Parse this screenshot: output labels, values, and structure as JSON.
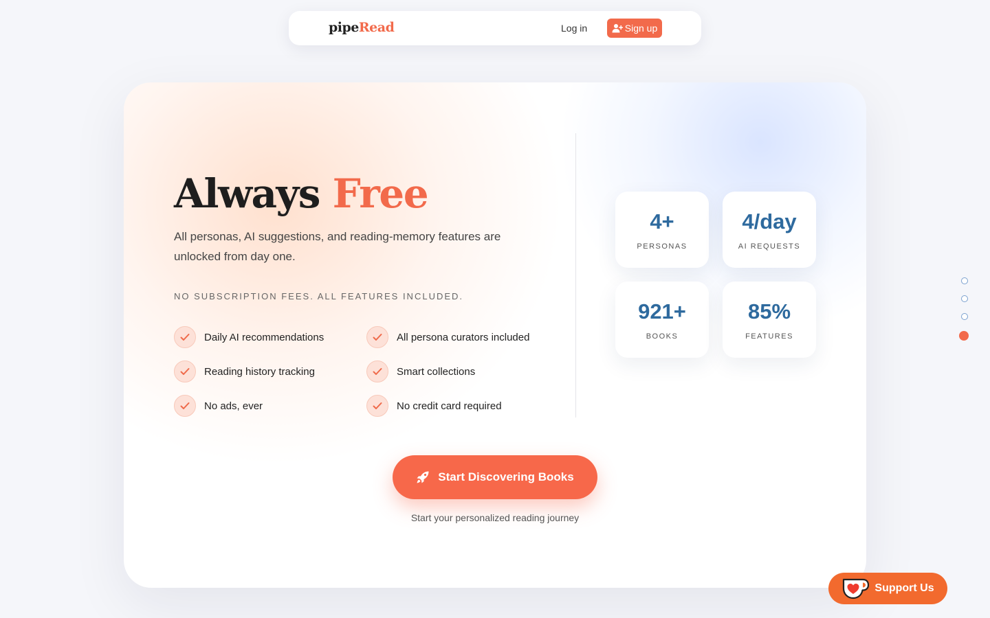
{
  "nav": {
    "logo_part1": "pipe",
    "logo_part2": "Read",
    "login_label": "Log in",
    "signup_label": "Sign up"
  },
  "hero": {
    "title_part1": "Always ",
    "title_part2": "Free",
    "description": "All personas, AI suggestions, and reading-memory features are unlocked from day one.",
    "tagline": "NO SUBSCRIPTION FEES. ALL FEATURES INCLUDED.",
    "features": [
      "Daily AI recommendations",
      "All persona curators included",
      "Reading history tracking",
      "Smart collections",
      "No ads, ever",
      "No credit card required"
    ]
  },
  "stats": [
    {
      "value": "4+",
      "label": "PERSONAS"
    },
    {
      "value": "4/day",
      "label": "AI REQUESTS"
    },
    {
      "value": "921+",
      "label": "BOOKS"
    },
    {
      "value": "85%",
      "label": "FEATURES"
    }
  ],
  "cta": {
    "label": "Start Discovering Books",
    "subtext": "Start your personalized reading journey"
  },
  "page_dots": {
    "count": 4,
    "active_index": 3
  },
  "support": {
    "label": "Support Us"
  },
  "colors": {
    "accent": "#f26a4b",
    "stat_value": "#2e6a9e",
    "support_button": "#f26a2e"
  },
  "icons": {
    "signup": "user-plus-icon",
    "feature": "check-icon",
    "cta": "rocket-icon",
    "support": "coffee-cup-heart-icon"
  }
}
